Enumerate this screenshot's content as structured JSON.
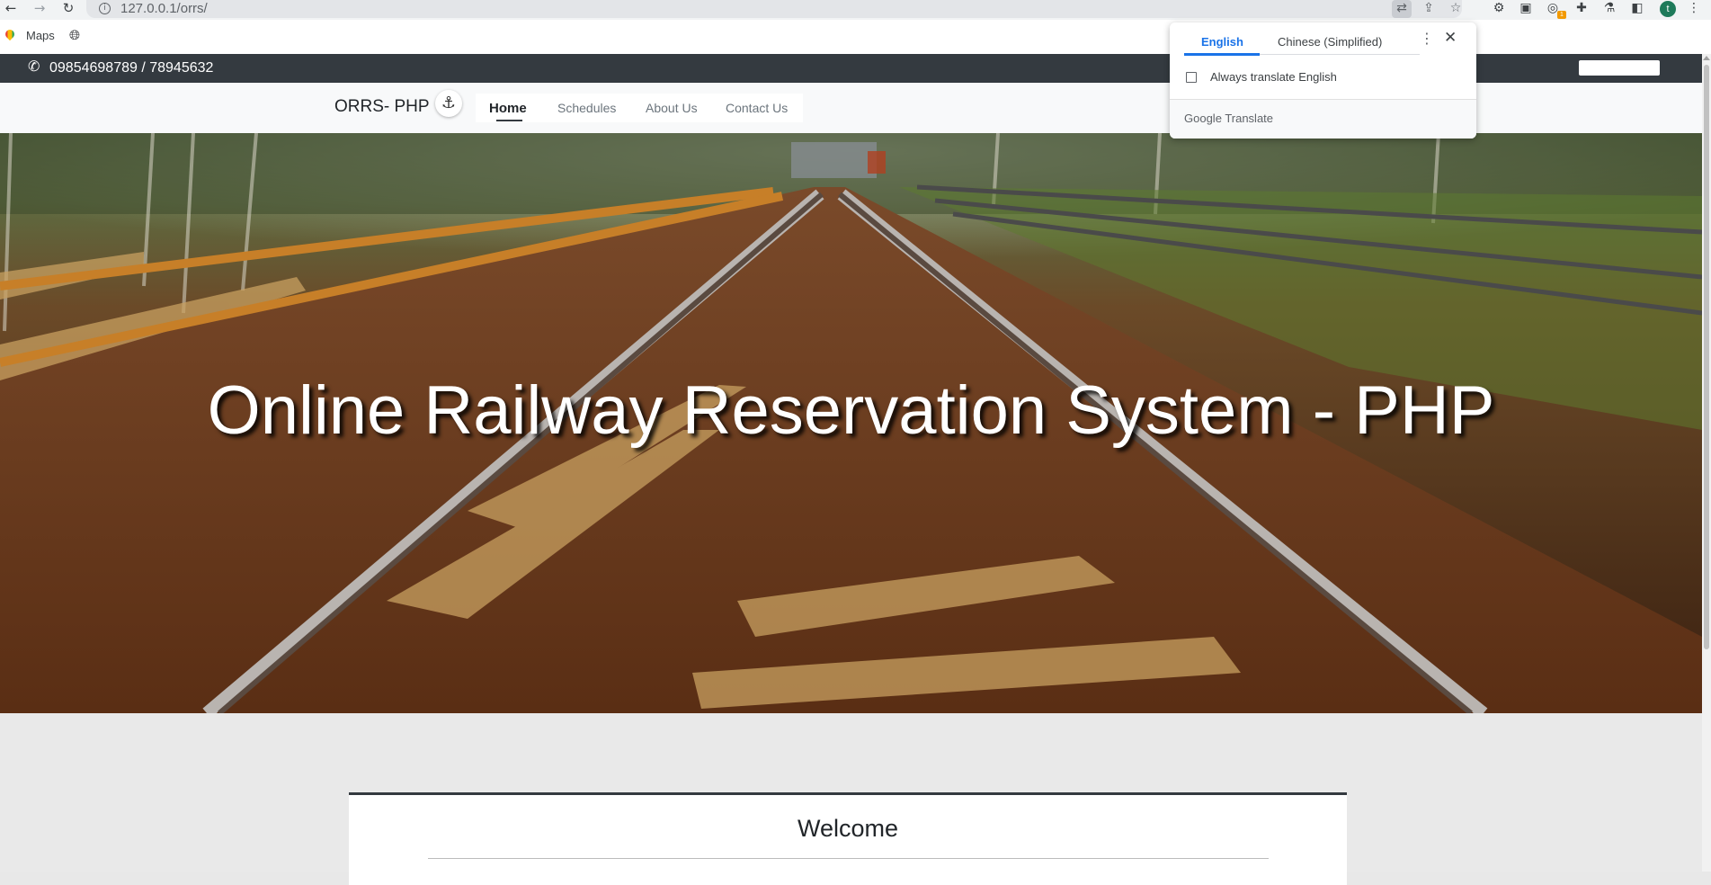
{
  "browser": {
    "url": "127.0.0.1/orrs/",
    "bookmarks": [
      {
        "label": "Maps"
      }
    ],
    "profile_initial": "t",
    "extension_badge": "1",
    "icons": {
      "back": "arrow-left-icon",
      "forward": "arrow-right-icon",
      "reload": "reload-icon",
      "site_info": "info-icon",
      "translate": "translate-icon",
      "share": "share-icon",
      "bookmark": "star-icon",
      "side_panel": "side-panel-icon",
      "menu": "kebab-menu-icon"
    }
  },
  "translate_popup": {
    "tabs": [
      "English",
      "Chinese (Simplified)"
    ],
    "active_tab": "English",
    "always_translate_label": "Always translate English",
    "always_translate_checked": false,
    "footer_google": "Google",
    "footer_translate": "Translate"
  },
  "site": {
    "contact": {
      "phone": "09854698789 / 78945632"
    },
    "brand": "ORRS- PHP",
    "nav": [
      {
        "label": "Home",
        "active": true
      },
      {
        "label": "Schedules",
        "active": false
      },
      {
        "label": "About Us",
        "active": false
      },
      {
        "label": "Contact Us",
        "active": false
      }
    ],
    "hero": {
      "title": "Online Railway Reservation System - PHP"
    },
    "welcome": {
      "title": "Welcome"
    }
  },
  "colors": {
    "topbar": "#343a40",
    "navbar": "#f8f9fa",
    "accent_translate": "#1a73e8",
    "page_bg": "#e9e9e9"
  }
}
